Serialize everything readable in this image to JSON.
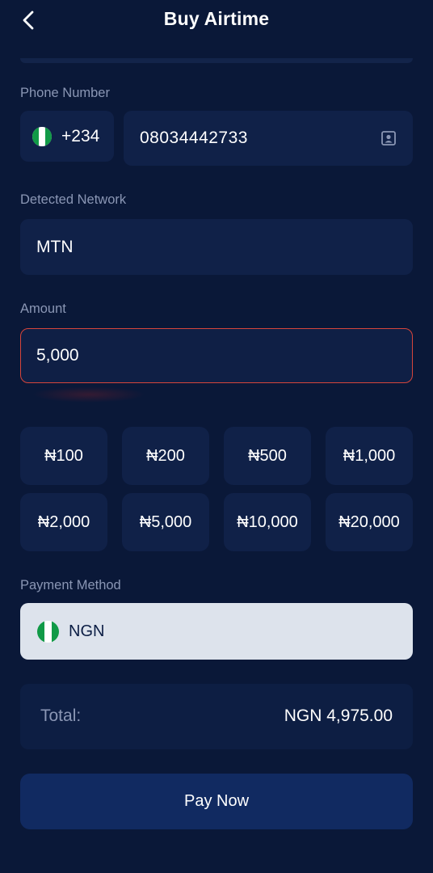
{
  "header": {
    "title": "Buy Airtime",
    "back_icon": "chevron-left-icon"
  },
  "phone": {
    "label": "Phone Number",
    "country_code": "+234",
    "number": "08034442733",
    "contact_icon": "contact-book-icon"
  },
  "network": {
    "label": "Detected Network",
    "value": "MTN"
  },
  "amount": {
    "label": "Amount",
    "value": "5,000"
  },
  "presets": [
    "₦100",
    "₦200",
    "₦500",
    "₦1,000",
    "₦2,000",
    "₦5,000",
    "₦10,000",
    "₦20,000"
  ],
  "payment": {
    "label": "Payment Method",
    "currency": "NGN"
  },
  "total": {
    "label": "Total:",
    "value": "NGN 4,975.00"
  },
  "pay_button": "Pay Now",
  "colors": {
    "background": "#0a1838",
    "field": "#102148",
    "error_border": "#d6453b",
    "flag_green": "#119a47",
    "button": "#112a61"
  }
}
